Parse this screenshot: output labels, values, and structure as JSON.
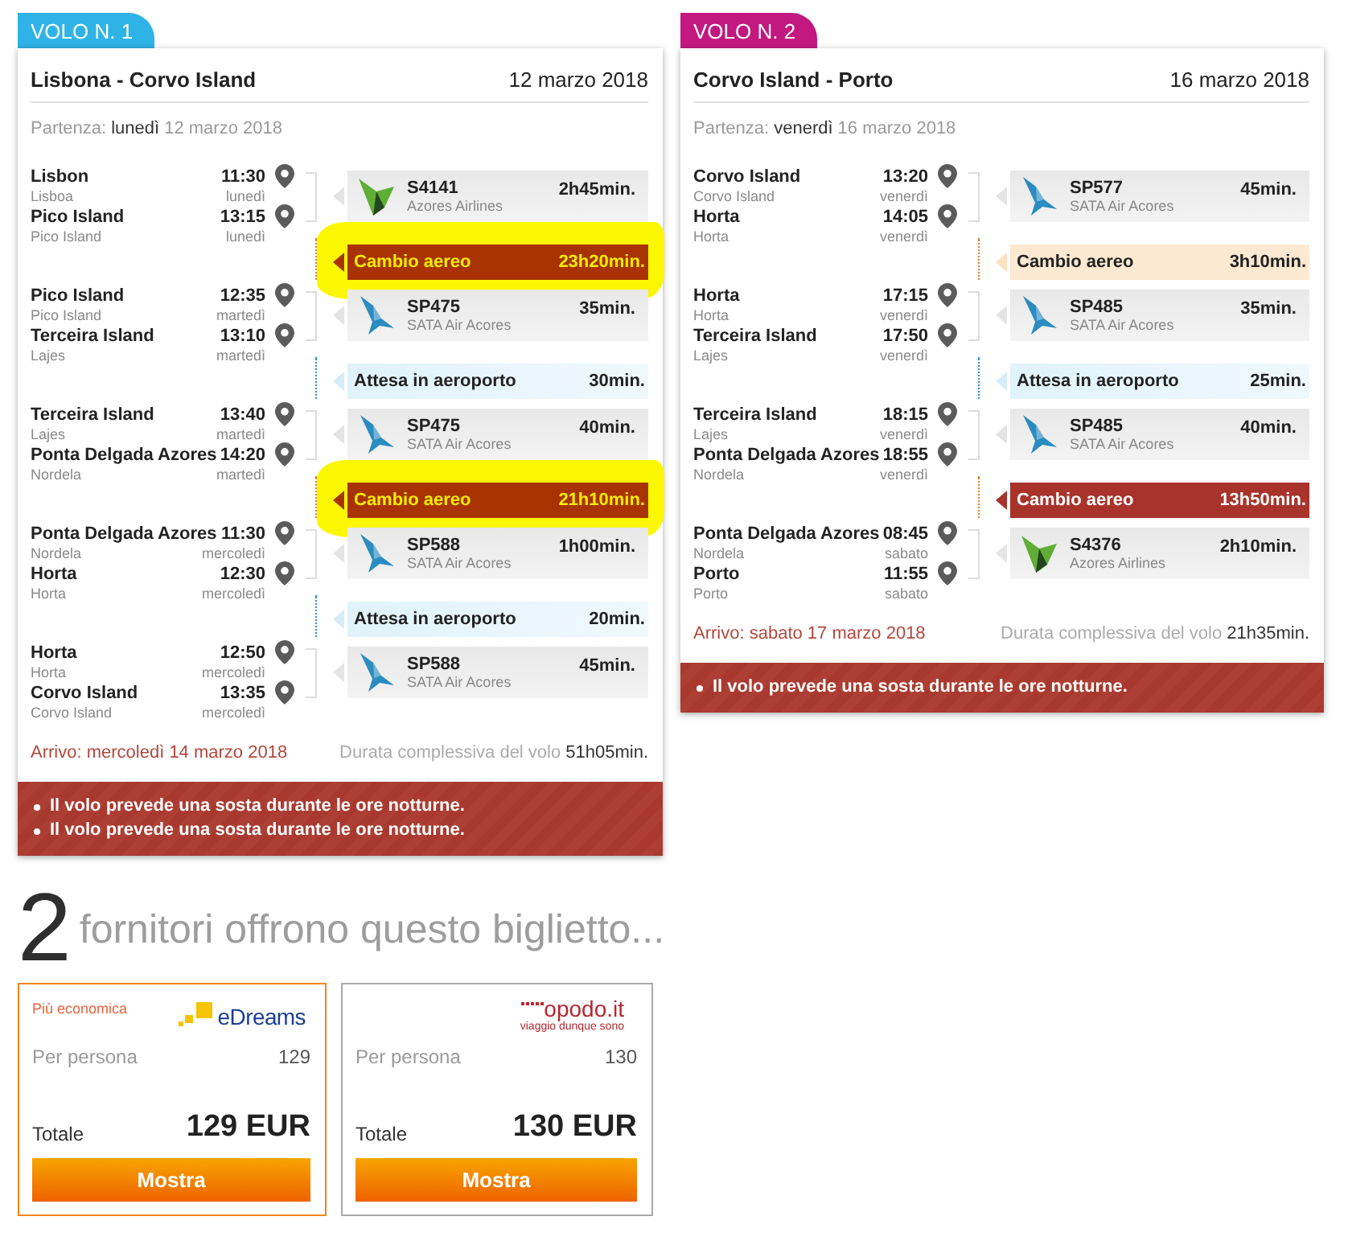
{
  "flights": [
    {
      "tab": "VOLO N. 1",
      "color": "#2fb3e6",
      "route": "Lisbona - Corvo Island",
      "date": "12 marzo 2018",
      "departure": {
        "label": "Partenza:",
        "day": "lunedì",
        "date": "12 marzo 2018"
      },
      "legs": [
        {
          "kind": "flight",
          "highlighted": false,
          "stops": [
            {
              "place": "Lisbon",
              "time": "11:30",
              "city": "Lisboa",
              "day": "lunedì"
            },
            {
              "place": "Pico Island",
              "time": "13:15",
              "city": "Pico Island",
              "day": "lunedì"
            }
          ],
          "logo": {
            "kind": "tail",
            "color": "#5fae35"
          },
          "number": "S4141",
          "airline": "Azores Airlines",
          "duration": "2h45min."
        },
        {
          "kind": "change",
          "highlighted": true,
          "overnight": true,
          "label": "Cambio aereo",
          "duration": "23h20min."
        },
        {
          "kind": "flight",
          "highlighted": false,
          "stops": [
            {
              "place": "Pico Island",
              "time": "12:35",
              "city": "Pico Island",
              "day": "martedì"
            },
            {
              "place": "Terceira Island",
              "time": "13:10",
              "city": "Lajes",
              "day": "martedì"
            }
          ],
          "logo": {
            "kind": "bird",
            "color": "#2a8cc0"
          },
          "number": "SP475",
          "airline": "SATA Air Acores",
          "duration": "35min."
        },
        {
          "kind": "wait",
          "highlighted": false,
          "overnight": false,
          "label": "Attesa in aeroporto",
          "duration": "30min."
        },
        {
          "kind": "flight",
          "highlighted": false,
          "stops": [
            {
              "place": "Terceira Island",
              "time": "13:40",
              "city": "Lajes",
              "day": "martedì"
            },
            {
              "place": "Ponta Delgada Azores",
              "time": "14:20",
              "city": "Nordela",
              "day": "martedì"
            }
          ],
          "logo": {
            "kind": "bird",
            "color": "#2a8cc0"
          },
          "number": "SP475",
          "airline": "SATA Air Acores",
          "duration": "40min."
        },
        {
          "kind": "change",
          "highlighted": true,
          "overnight": true,
          "label": "Cambio aereo",
          "duration": "21h10min."
        },
        {
          "kind": "flight",
          "highlighted": false,
          "stops": [
            {
              "place": "Ponta Delgada Azores",
              "time": "11:30",
              "city": "Nordela",
              "day": "mercoledì"
            },
            {
              "place": "Horta",
              "time": "12:30",
              "city": "Horta",
              "day": "mercoledì"
            }
          ],
          "logo": {
            "kind": "bird",
            "color": "#2a8cc0"
          },
          "number": "SP588",
          "airline": "SATA Air Acores",
          "duration": "1h00min."
        },
        {
          "kind": "wait",
          "highlighted": false,
          "overnight": false,
          "label": "Attesa in aeroporto",
          "duration": "20min."
        },
        {
          "kind": "flight",
          "highlighted": false,
          "stops": [
            {
              "place": "Horta",
              "time": "12:50",
              "city": "Horta",
              "day": "mercoledì"
            },
            {
              "place": "Corvo Island",
              "time": "13:35",
              "city": "Corvo Island",
              "day": "mercoledì"
            }
          ],
          "logo": {
            "kind": "bird",
            "color": "#2a8cc0"
          },
          "number": "SP588",
          "airline": "SATA Air Acores",
          "duration": "45min."
        }
      ],
      "arrival": "Arrivo: mercoledì 14 marzo 2018",
      "total_label": "Durata complessiva del volo",
      "total": "51h05min.",
      "notices": [
        "Il volo prevede una sosta durante le ore notturne.",
        "Il volo prevede una sosta durante le ore notturne."
      ]
    },
    {
      "tab": "VOLO N. 2",
      "color": "#c2187f",
      "route": "Corvo Island - Porto",
      "date": "16 marzo 2018",
      "departure": {
        "label": "Partenza:",
        "day": "venerdì",
        "date": "16 marzo 2018"
      },
      "legs": [
        {
          "kind": "flight",
          "highlighted": false,
          "stops": [
            {
              "place": "Corvo Island",
              "time": "13:20",
              "city": "Corvo Island",
              "day": "venerdì"
            },
            {
              "place": "Horta",
              "time": "14:05",
              "city": "Horta",
              "day": "venerdì"
            }
          ],
          "logo": {
            "kind": "bird",
            "color": "#2a8cc0"
          },
          "number": "SP577",
          "airline": "SATA Air Acores",
          "duration": "45min."
        },
        {
          "kind": "change",
          "highlighted": false,
          "overnight": false,
          "label": "Cambio aereo",
          "duration": "3h10min."
        },
        {
          "kind": "flight",
          "highlighted": false,
          "stops": [
            {
              "place": "Horta",
              "time": "17:15",
              "city": "Horta",
              "day": "venerdì"
            },
            {
              "place": "Terceira Island",
              "time": "17:50",
              "city": "Lajes",
              "day": "venerdì"
            }
          ],
          "logo": {
            "kind": "bird",
            "color": "#2a8cc0"
          },
          "number": "SP485",
          "airline": "SATA Air Acores",
          "duration": "35min."
        },
        {
          "kind": "wait",
          "highlighted": false,
          "overnight": false,
          "label": "Attesa in aeroporto",
          "duration": "25min."
        },
        {
          "kind": "flight",
          "highlighted": false,
          "stops": [
            {
              "place": "Terceira Island",
              "time": "18:15",
              "city": "Lajes",
              "day": "venerdì"
            },
            {
              "place": "Ponta Delgada Azores",
              "time": "18:55",
              "city": "Nordela",
              "day": "venerdì"
            }
          ],
          "logo": {
            "kind": "bird",
            "color": "#2a8cc0"
          },
          "number": "SP485",
          "airline": "SATA Air Acores",
          "duration": "40min."
        },
        {
          "kind": "change",
          "highlighted": false,
          "overnight": true,
          "label": "Cambio aereo",
          "duration": "13h50min."
        },
        {
          "kind": "flight",
          "highlighted": false,
          "stops": [
            {
              "place": "Ponta Delgada Azores",
              "time": "08:45",
              "city": "Nordela",
              "day": "sabato"
            },
            {
              "place": "Porto",
              "time": "11:55",
              "city": "Porto",
              "day": "sabato"
            }
          ],
          "logo": {
            "kind": "tail",
            "color": "#5fae35"
          },
          "number": "S4376",
          "airline": "Azores Airlines",
          "duration": "2h10min."
        }
      ],
      "arrival": "Arrivo: sabato 17 marzo 2018",
      "total_label": "Durata complessiva del volo",
      "total": "21h35min.",
      "notices": [
        "Il volo prevede una sosta durante le ore notturne."
      ]
    }
  ],
  "offers": {
    "count": "2",
    "text": "fornitori offrono questo biglietto..."
  },
  "providers": [
    {
      "cheapest": true,
      "badge": "Più economica",
      "logo": {
        "kind": "squares",
        "name": "eDreams"
      },
      "per_person_label": "Per persona",
      "per_person": "129",
      "total_label": "Totale",
      "total": "129 EUR",
      "button": "Mostra"
    },
    {
      "cheapest": false,
      "logo": {
        "kind": "dots",
        "name": "opodo.it",
        "tagline": "viaggio dunque sono"
      },
      "per_person_label": "Per persona",
      "per_person": "130",
      "total_label": "Totale",
      "total": "130 EUR",
      "button": "Mostra"
    }
  ]
}
